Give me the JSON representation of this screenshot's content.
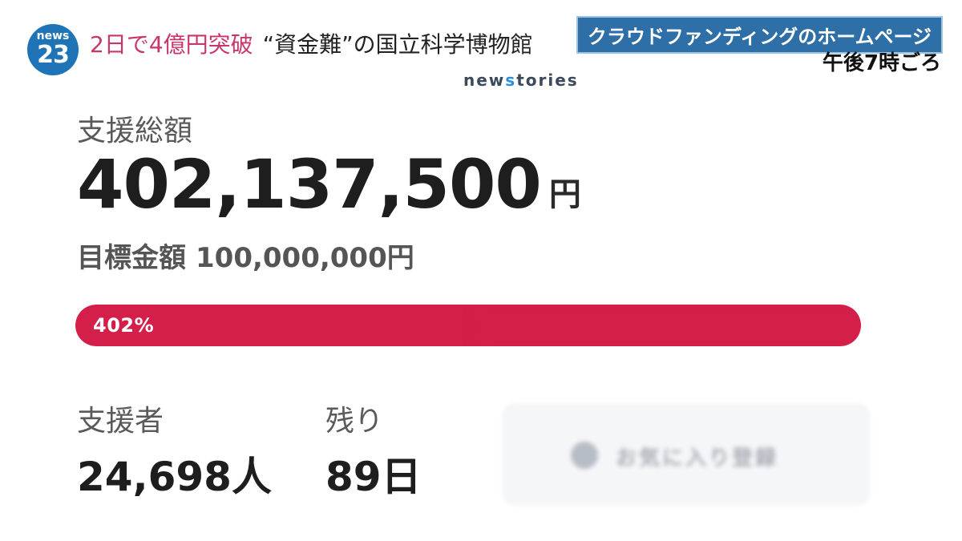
{
  "overlay": {
    "logo_brand": "news",
    "logo_number": "23",
    "headline_accent": "2日で4億円突破",
    "headline_rest": "“資金難”の国立科学博物館",
    "watermark_prefix": "new",
    "watermark_s": "s",
    "watermark_suffix": "tories",
    "caption": "クラウドファンディングのホームページ",
    "caption_time": "午後7時ごろ",
    "colors": {
      "logo_blue": "#1f74b8",
      "headline_accent": "#c9366e",
      "caption_bg": "#2f6fa7"
    }
  },
  "campaign": {
    "total_label": "支援総額",
    "total_amount": "402,137,500",
    "total_unit": "円",
    "target_label": "目標金額",
    "target_value": "100,000,000円",
    "progress": {
      "label": "402%",
      "percent": 402,
      "fill_color": "#d41f4a"
    },
    "supporters_label": "支援者",
    "supporters_value": "24,698人",
    "remaining_label": "残り",
    "remaining_value": "89日",
    "blurred_button": {
      "icon": "heart-icon",
      "label": "お気に入り登録"
    }
  }
}
